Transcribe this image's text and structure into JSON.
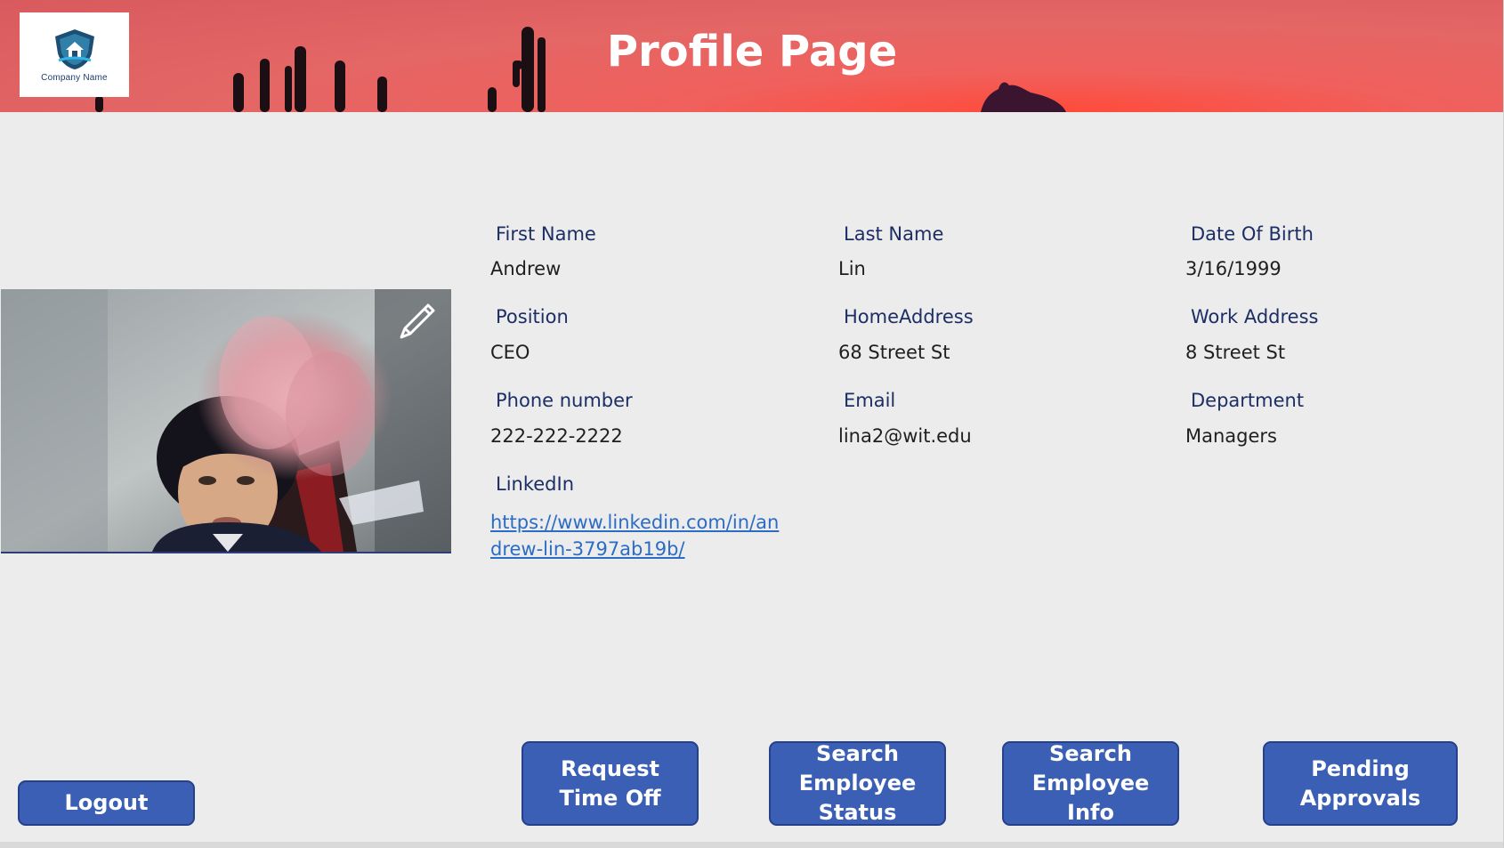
{
  "header": {
    "title": "Profile Page",
    "logo_text": "Company Name"
  },
  "profile": {
    "fields": [
      {
        "label": "First Name",
        "value": "Andrew"
      },
      {
        "label": "Last Name",
        "value": "Lin"
      },
      {
        "label": "Date Of Birth",
        "value": "3/16/1999"
      },
      {
        "label": "Position",
        "value": "CEO"
      },
      {
        "label": "HomeAddress",
        "value": "68 Street St"
      },
      {
        "label": "Work Address",
        "value": "8 Street St"
      },
      {
        "label": "Phone number",
        "value": "222-222-2222"
      },
      {
        "label": "Email",
        "value": "lina2@wit.edu"
      },
      {
        "label": "Department",
        "value": "Managers"
      }
    ],
    "linkedin": {
      "label": "LinkedIn",
      "url": "https://www.linkedin.com/in/andrew-lin-3797ab19b/"
    }
  },
  "buttons": {
    "logout": "Logout",
    "request_time_off": "Request Time Off",
    "search_employee_status": "Search Employee Status",
    "search_employee_info": "Search Employee Info",
    "pending_approvals": "Pending Approvals"
  },
  "colors": {
    "header_red": "#e46665",
    "button_blue": "#3a5fb5",
    "label_navy": "#1c2e64",
    "link_blue": "#2b6cc4"
  },
  "icons": [
    "company-logo-icon",
    "pencil-edit-icon"
  ]
}
